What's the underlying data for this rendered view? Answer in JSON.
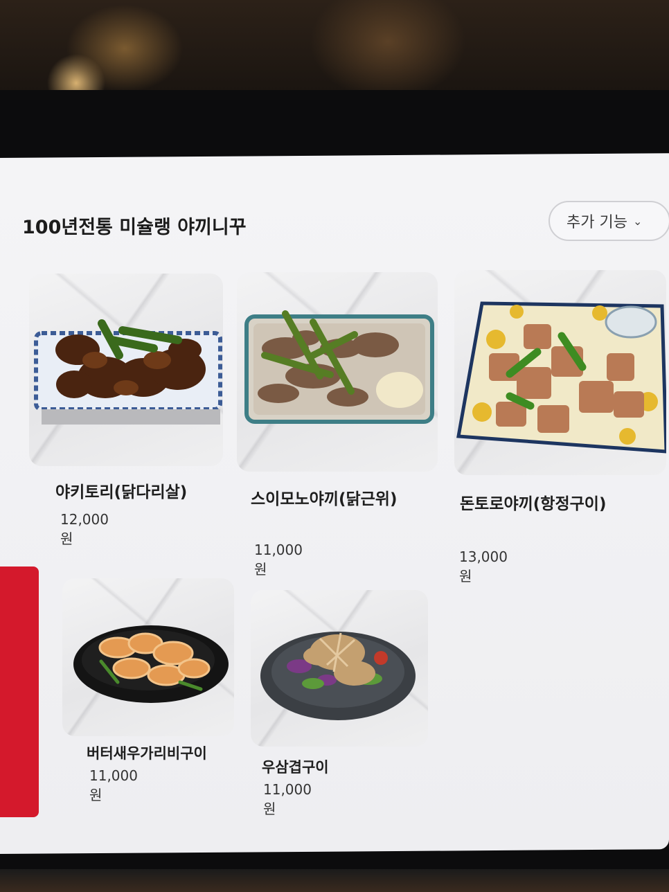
{
  "header": {
    "title": "100년전통 미슐랭 야끼니꾸",
    "more_label": "추가 기능"
  },
  "items": [
    {
      "name": "야키토리(닭다리살)",
      "price": "12,000원"
    },
    {
      "name": "스이모노야끼(닭근위)",
      "price": "11,000원"
    },
    {
      "name": "돈토로야끼(항정구이)",
      "price": "13,000원"
    },
    {
      "name": "버터새우가리비구이",
      "price": "11,000원"
    },
    {
      "name": "우삼겹구이",
      "price": "11,000원"
    }
  ],
  "colors": {
    "accent_red": "#d4192c",
    "screen_bg": "#f1f1f3"
  }
}
